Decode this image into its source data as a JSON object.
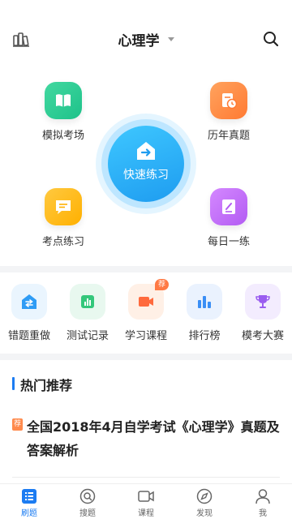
{
  "header": {
    "title": "心理学",
    "left_icon": "subjects-icon",
    "right_icon": "search-icon"
  },
  "hero": {
    "quick_practice": "快速练习",
    "features": {
      "mock_exam": "模拟考场",
      "past_papers": "历年真题",
      "point_practice": "考点练习",
      "daily_practice": "每日一练"
    }
  },
  "grid": {
    "items": [
      {
        "label": "错题重做",
        "icon": "redo-wrong-icon"
      },
      {
        "label": "测试记录",
        "icon": "test-record-icon"
      },
      {
        "label": "学习课程",
        "icon": "video-course-icon",
        "badge": "荐"
      },
      {
        "label": "排行榜",
        "icon": "leaderboard-icon"
      },
      {
        "label": "模考大赛",
        "icon": "trophy-icon"
      }
    ]
  },
  "hot": {
    "title": "热门推荐",
    "article": {
      "tag": "荐",
      "title": "全国2018年4月自学考试《心理学》真题及答案解析"
    }
  },
  "tabbar": {
    "items": [
      {
        "label": "刷题",
        "active": true
      },
      {
        "label": "搜题"
      },
      {
        "label": "课程"
      },
      {
        "label": "发现"
      },
      {
        "label": "我"
      }
    ]
  },
  "colors": {
    "accent": "#1c7cf2",
    "quick_button": "#27aef5",
    "mock": "#2fcf94",
    "past": "#ff8a44",
    "point": "#ffbe22",
    "daily": "#c070f8"
  }
}
